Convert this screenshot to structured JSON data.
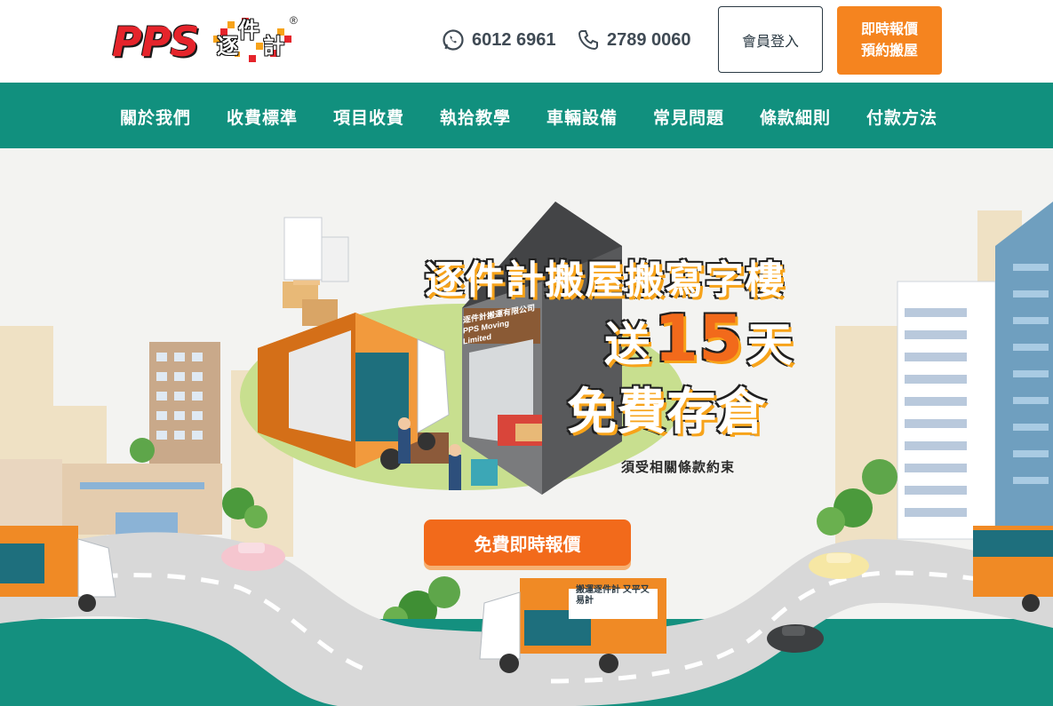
{
  "header": {
    "logo_text": "PPS",
    "logo_cn": [
      "逐",
      "件",
      "計"
    ],
    "logo_reg": "®",
    "whatsapp_number": "6012 6961",
    "phone_number": "2789 0060",
    "login_label": "會員登入",
    "quote_line1": "即時報價",
    "quote_line2": "預約搬屋"
  },
  "nav": {
    "items": [
      "關於我們",
      "收費標準",
      "項目收費",
      "執拾教學",
      "車輛設備",
      "常見問題",
      "條款細則",
      "付款方法"
    ]
  },
  "hero": {
    "title_line1": "逐件計搬屋搬寫字樓",
    "title_line2_pre": "送",
    "title_line2_num": "15",
    "title_line2_post": "天",
    "title_line3": "免費存倉",
    "terms_note": "須受相關條款約束",
    "cta_label": "免費即時報價",
    "truck_company_cn": "逐件計搬運有限公司",
    "truck_company_en": "PPS Moving Limited",
    "truck_slogan": "搬運逐件計 又平又易計"
  },
  "colors": {
    "brand_orange": "#f5841f",
    "nav_green": "#11907e",
    "cta_orange": "#f26a1b",
    "ground_green": "#14907f"
  }
}
